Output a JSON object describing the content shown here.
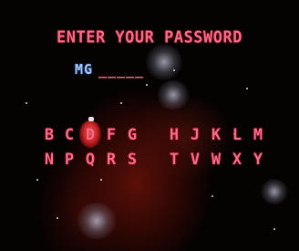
{
  "prompt": "ENTER YOUR PASSWORD",
  "password": {
    "entered": "MG",
    "blanks": "_____"
  },
  "keyboard": {
    "row1": [
      "B",
      "C",
      "D",
      "F",
      "G",
      "H",
      "J",
      "K",
      "L",
      "M"
    ],
    "row2": [
      "N",
      "P",
      "Q",
      "R",
      "S",
      "T",
      "V",
      "W",
      "X",
      "Y"
    ],
    "selected": "D"
  },
  "colors": {
    "letters": "#ff6a84",
    "entered_text": "#9ec8ff",
    "cursor": "#e62828",
    "background": "#050202"
  }
}
